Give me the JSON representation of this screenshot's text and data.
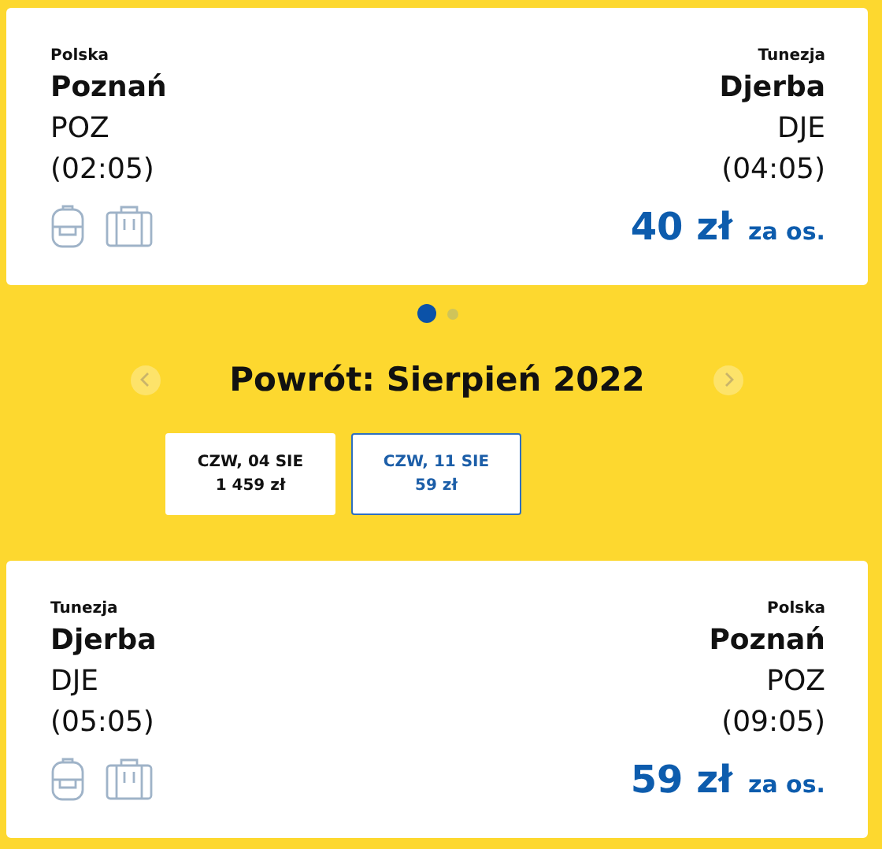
{
  "outbound": {
    "origin": {
      "country": "Polska",
      "city": "Poznań",
      "code": "POZ",
      "time": "(02:05)"
    },
    "destination": {
      "country": "Tunezja",
      "city": "Djerba",
      "code": "DJE",
      "time": "(04:05)"
    },
    "price": "40 zł",
    "price_note": "za os."
  },
  "carousel_dots": [
    {
      "selected": true
    },
    {
      "selected": false
    }
  ],
  "return_heading": "Powrót: Sierpień 2022",
  "return_dates": [
    {
      "day": "CZW, 04 SIE",
      "price": "1 459 zł",
      "selected": false
    },
    {
      "day": "CZW, 11 SIE",
      "price": "59 zł",
      "selected": true
    }
  ],
  "inbound": {
    "origin": {
      "country": "Tunezja",
      "city": "Djerba",
      "code": "DJE",
      "time": "(05:05)"
    },
    "destination": {
      "country": "Polska",
      "city": "Poznań",
      "code": "POZ",
      "time": "(09:05)"
    },
    "price": "59 zł",
    "price_note": "za os."
  }
}
